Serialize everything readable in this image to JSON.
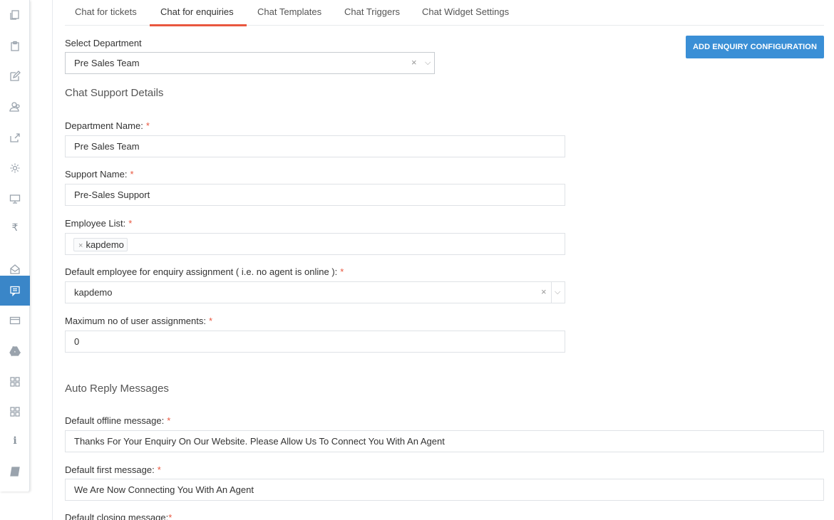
{
  "sidebar": {
    "items": [
      {
        "icon": "copy-icon"
      },
      {
        "icon": "clipboard-icon"
      },
      {
        "icon": "edit-icon"
      },
      {
        "icon": "users-icon"
      },
      {
        "icon": "share-icon"
      },
      {
        "icon": "gear-icon"
      },
      {
        "icon": "monitor-icon"
      },
      {
        "icon": "rupee-icon",
        "glyph": "₹"
      },
      {
        "icon": "inbox-icon"
      },
      {
        "icon": "chat-icon",
        "active": true
      },
      {
        "icon": "card-icon"
      },
      {
        "icon": "drive-icon"
      },
      {
        "icon": "grid-icon"
      },
      {
        "icon": "grid-icon"
      },
      {
        "icon": "info-icon",
        "glyph": "i"
      },
      {
        "icon": "book-icon"
      }
    ],
    "active_color": "#3a86c8"
  },
  "tabs": [
    {
      "label": "Chat for tickets"
    },
    {
      "label": "Chat for enquiries",
      "active": true
    },
    {
      "label": "Chat Templates"
    },
    {
      "label": "Chat Triggers"
    },
    {
      "label": "Chat Widget Settings"
    }
  ],
  "select_department": {
    "label": "Select Department",
    "value": "Pre Sales Team"
  },
  "add_button_label": "ADD ENQUIRY CONFIGURATION",
  "chat_support": {
    "title": "Chat Support Details",
    "department_name_label": "Department Name:",
    "department_name": "Pre Sales Team",
    "support_name_label": "Support Name:",
    "support_name": "Pre-Sales Support",
    "employee_list_label": "Employee List:",
    "employee_tag": "kapdemo",
    "default_employee_label": "Default employee for enquiry assignment ( i.e. no agent is online ):",
    "default_employee": "kapdemo",
    "max_assign_label": "Maximum no of user assignments:",
    "max_assign": "0"
  },
  "auto_reply": {
    "title": "Auto Reply Messages",
    "offline_label": "Default offline message:",
    "offline_value": "Thanks For Your Enquiry On Our Website. Please Allow Us To Connect You With An Agent",
    "first_label": "Default first message:",
    "first_value": "We Are Now Connecting You With An Agent",
    "closing_label": "Default closing message:"
  },
  "required_mark": "*",
  "clear_glyph": "×",
  "arrow_glyph": "⌵",
  "accent_color": "#e9573f",
  "button_color": "#3a8fd6"
}
